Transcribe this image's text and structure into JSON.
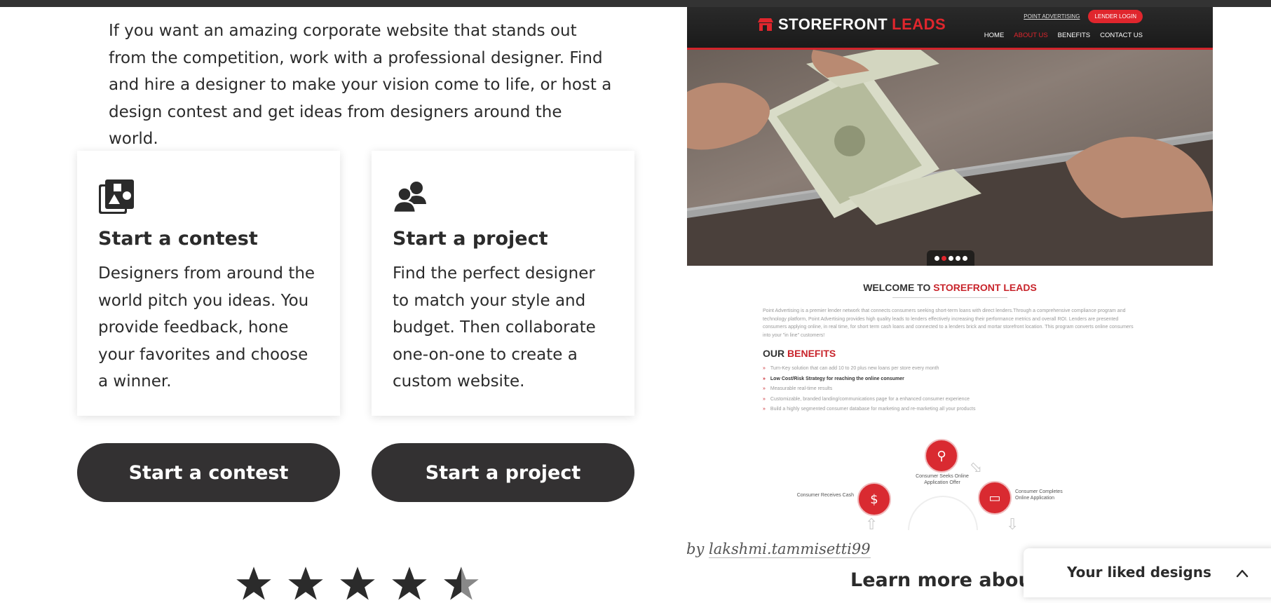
{
  "intro": {
    "text": "If you want an amazing corporate website that stands out from the competition, work with a professional designer. Find and hire a designer to make your vision come to life, or host a design contest and get ideas from designers around the world."
  },
  "cards": [
    {
      "icon": "contest-images-icon",
      "title": "Start a contest",
      "description": "Designers from around the world pitch you ideas. You provide feedback, hone your favorites and choose a winner."
    },
    {
      "icon": "people-icon",
      "title": "Start a project",
      "description": "Find the perfect designer to match your style and budget. Then collaborate one-on-one to create a custom website."
    }
  ],
  "buttons": {
    "contest": "Start a contest",
    "project": "Start a project"
  },
  "rating": {
    "stars": 4.5,
    "max": 5
  },
  "showcase": {
    "credit_prefix": "by",
    "designer": "lakshmi.tammisetti99",
    "mock": {
      "logo_main": "STOREFRONT",
      "logo_accent": "LEADS",
      "top_link": "POINT ADVERTISING",
      "lender_login": "LENDER LOGIN",
      "nav": [
        "HOME",
        "ABOUT US",
        "BENEFITS",
        "CONTACT US"
      ],
      "nav_active_index": 1,
      "slider_dots": 5,
      "slider_active_index": 1,
      "welcome_prefix": "WELCOME TO",
      "welcome_accent": "STOREFRONT LEADS",
      "paragraph": "Point Advertising is a premier lender network that connects consumers seeking short-term loans with direct lenders.Through a comprehensive compliance program and technology platform, Point Advertising provides high quality leads to lenders effectively increasing their performance metrics and overall ROI. Lenders are presented consumers applying online, in real time, for short term cash loans and connected to a lenders brick and mortar storefront location. This program converts online consumers into your \"in line\" customers!",
      "benefits_prefix": "OUR",
      "benefits_accent": "BENEFITS",
      "benefits": [
        "Turn-Key solution that can add 10 to 20 plus new loans per store every month",
        "Low Cost/Risk Strategy for reaching the online consumer",
        "Measurable real-time results",
        "Customizable, branded landing/communications page for a enhanced consumer experience",
        "Build a highly segmented consumer database for marketing and re-marketing all your products"
      ],
      "benefits_strong_index": 1,
      "steps": {
        "seeks": "Consumer Seeks Online Application Offer",
        "completes": "Consumer Completes Online Application",
        "receives": "Consumer Receives Cash"
      }
    }
  },
  "learn_more": "Learn more about",
  "liked": {
    "label": "Your liked designs"
  },
  "colors": {
    "button_bg": "#333132",
    "accent_red": "#e0262d",
    "text": "#2b2b2b"
  }
}
